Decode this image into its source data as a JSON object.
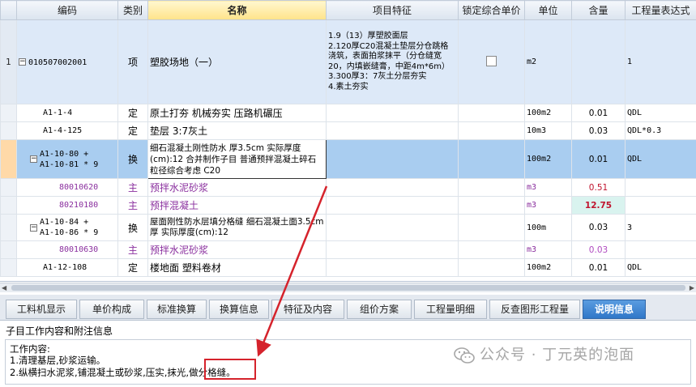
{
  "columns": [
    "",
    "编码",
    "类别",
    "名称",
    "项目特征",
    "锁定综合单价",
    "单位",
    "含量",
    "工程量表达式"
  ],
  "rows": [
    {
      "num": "1",
      "code": "010507002001",
      "type": "项",
      "name": "塑胶场地（一）",
      "feature": "1.9（13）厚塑胶面层\n2.120厚C20混凝土垫层分仓跳格浇筑，表面拍浆抹平（分仓缝宽20，内填嵌缝膏，中距4m*6m）\n3.300厚3：7灰土分层夯实\n4.素土夯实",
      "unit": "m2",
      "qty": "",
      "expr": "1"
    },
    {
      "num": "",
      "code": "A1-1-4",
      "type": "定",
      "name": "原土打夯 机械夯实 压路机碾压",
      "feature": "",
      "unit": "100m2",
      "qty": "0.01",
      "expr": "QDL"
    },
    {
      "num": "",
      "code": "A1-4-125",
      "type": "定",
      "name": "垫层 3:7灰土",
      "feature": "",
      "unit": "10m3",
      "qty": "0.03",
      "expr": "QDL*0.3"
    },
    {
      "num": "",
      "code": "A1-10-80 +\nA1-10-81 * 9",
      "type": "换",
      "name": "细石混凝土刚性防水 厚3.5cm  实际厚度(cm):12  合并制作子目 普通预拌混凝土碎石粒径综合考虑 C20",
      "feature": "",
      "unit": "100m2",
      "qty": "0.01",
      "expr": "QDL"
    },
    {
      "num": "",
      "code": "80010620",
      "type": "主",
      "name": "预拌水泥砂浆",
      "feature": "",
      "unit": "m3",
      "qty": "0.51",
      "expr": ""
    },
    {
      "num": "",
      "code": "80210180",
      "type": "主",
      "name": "预拌混凝土",
      "feature": "",
      "unit": "m3",
      "qty": "12.75",
      "expr": ""
    },
    {
      "num": "",
      "code": "A1-10-84 +\nA1-10-86 * 9",
      "type": "换",
      "name": "屋面刚性防水层填分格缝 细石混凝土面3.5cm厚  实际厚度(cm):12",
      "feature": "",
      "unit": "100m",
      "qty": "0.03",
      "expr": "3"
    },
    {
      "num": "",
      "code": "80010630",
      "type": "主",
      "name": "预拌水泥砂浆",
      "feature": "",
      "unit": "m3",
      "qty": "0.03",
      "expr": ""
    },
    {
      "num": "",
      "code": "A1-12-108",
      "type": "定",
      "name": "楼地面 塑料卷材",
      "feature": "",
      "unit": "100m2",
      "qty": "0.01",
      "expr": "QDL"
    }
  ],
  "tabs": [
    "工料机显示",
    "单价构成",
    "标准换算",
    "换算信息",
    "特征及内容",
    "组价方案",
    "工程量明细",
    "反查图形工程量",
    "说明信息"
  ],
  "active_tab": "说明信息",
  "panel": {
    "title": "子目工作内容和附注信息",
    "heading": "工作内容:",
    "line1": "1.清理基层,砂浆运输。",
    "line2": "2.纵横扫水泥浆,铺混凝土或砂浆,压实,抹光,做分格缝。"
  },
  "watermark": "公众号 · 丁元英的泡面",
  "colors": {
    "accent": "#2f77c8",
    "highlight_red": "#d5232c",
    "selected_row": "#a9cdf0",
    "material_purple": "#8a2f9e"
  }
}
